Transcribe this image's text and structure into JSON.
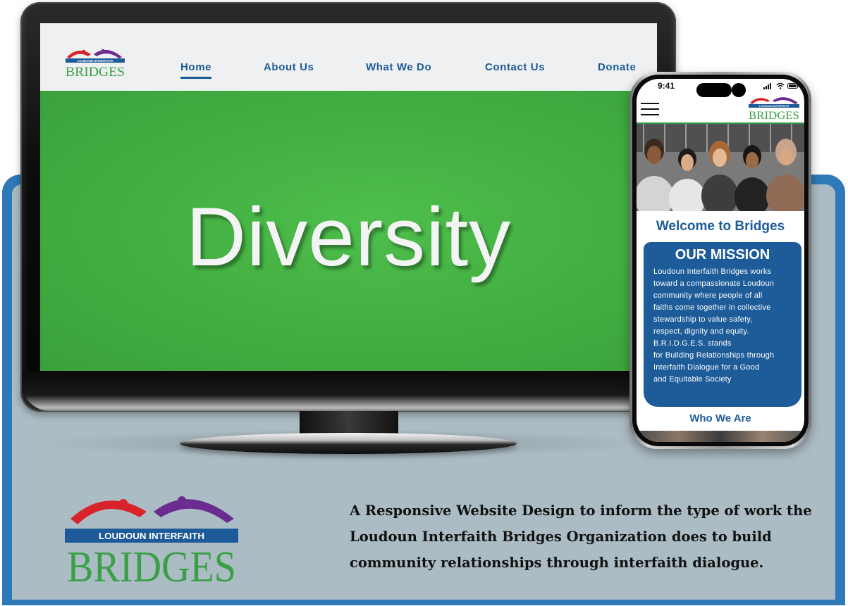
{
  "brand": {
    "org_line": "LOUDOUN INTERFAITH",
    "name": "BRIDGES",
    "colors": {
      "blue": "#1c5a99",
      "green": "#3aa047",
      "red": "#d8232a",
      "purple": "#6b2c8f"
    }
  },
  "nav": {
    "items": [
      {
        "label": "Home",
        "active": true
      },
      {
        "label": "About Us",
        "active": false
      },
      {
        "label": "What We Do",
        "active": false
      },
      {
        "label": "Contact Us",
        "active": false
      },
      {
        "label": "Donate",
        "active": false
      }
    ]
  },
  "hero": {
    "word": "Diversity",
    "bg_color": "#45b244"
  },
  "phone": {
    "status_time": "9:41",
    "welcome": "Welcome to Bridges",
    "mission_title": "OUR MISSION",
    "mission_lines": [
      "Loudoun Interfaith Bridges works",
      "toward a compassionate Loudoun",
      "community where people of all",
      "faiths come together in collective",
      "stewardship to value safety,",
      "respect, dignity and equity.",
      "B.R.I.D.G.E.S. stands",
      "for Building Relationships through",
      "Interfaith Dialogue for a Good",
      "and Equitable Society"
    ],
    "section_link": "Who We Are",
    "icons": [
      "menu-icon",
      "signal-icon",
      "wifi-icon",
      "battery-icon"
    ]
  },
  "tagline": {
    "lines": [
      "A Responsive Website Design to inform the type of work the",
      "Loudoun Interfaith Bridges Organization does to build",
      "community relationships through interfaith dialogue."
    ]
  }
}
